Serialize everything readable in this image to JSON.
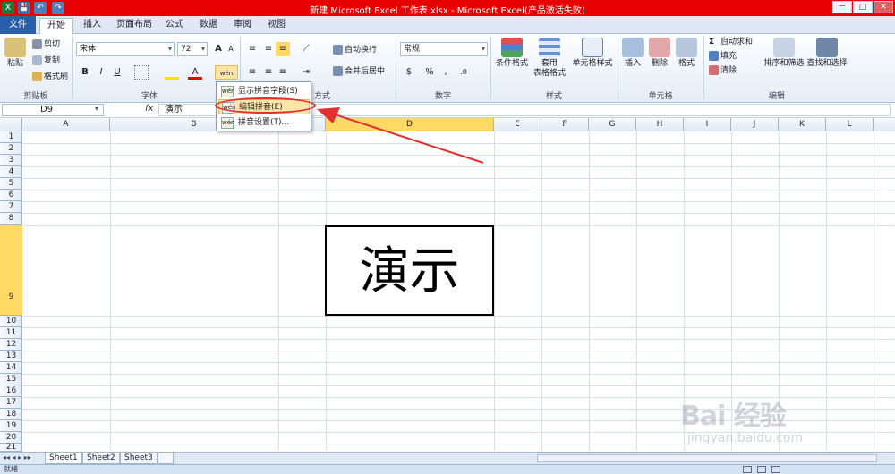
{
  "window": {
    "title": "新建 Microsoft Excel 工作表.xlsx - Microsoft Excel(产品激活失败)",
    "controls": [
      "－",
      "□",
      "✕"
    ]
  },
  "quick_access": [
    "X",
    "💾",
    "↶",
    "↷"
  ],
  "tabs": [
    "文件",
    "开始",
    "插入",
    "页面布局",
    "公式",
    "数据",
    "审阅",
    "视图"
  ],
  "ribbon": {
    "clipboard": {
      "label": "剪贴板",
      "paste": "粘贴",
      "cut": "剪切",
      "copy": "复制",
      "format_painter": "格式刷"
    },
    "font": {
      "label": "字体",
      "font_name": "宋体",
      "font_size": "72",
      "bold": "B",
      "italic": "I",
      "underline": "U",
      "grow": "A",
      "shrink": "A",
      "phonetic_icon": "wén"
    },
    "alignment": {
      "label": "方式",
      "wrap": "自动换行",
      "merge": "合并后居中"
    },
    "number": {
      "label": "数字",
      "format": "常规",
      "percent": "%",
      "comma": ","
    },
    "styles": {
      "label": "样式",
      "conditional": "条件格式",
      "table_line1": "套用",
      "table_line2": "表格格式",
      "cell_styles": "单元格样式"
    },
    "cells": {
      "label": "单元格",
      "insert": "插入",
      "delete": "删除",
      "format": "格式"
    },
    "editing": {
      "label": "编辑",
      "autosum": "自动求和",
      "fill": "填充",
      "clear": "清除",
      "sort": "排序和筛选",
      "find": "查找和选择"
    }
  },
  "phonetic_menu": {
    "items": [
      {
        "label": "显示拼音字段(S)",
        "icon": "wén"
      },
      {
        "label": "编辑拼音(E)",
        "icon": "wén"
      },
      {
        "label": "拼音设置(T)...",
        "icon": "wén"
      }
    ]
  },
  "formula_bar": {
    "name_box": "D9",
    "fx": "fx",
    "value": "演示"
  },
  "columns": [
    "A",
    "B",
    "C",
    "D",
    "E",
    "F",
    "G",
    "H",
    "I",
    "J",
    "K",
    "L"
  ],
  "rows": [
    "1",
    "2",
    "3",
    "4",
    "5",
    "6",
    "7",
    "8",
    "9",
    "10",
    "11",
    "12",
    "13",
    "14",
    "15",
    "16",
    "17",
    "18",
    "19",
    "20",
    "21"
  ],
  "cell_d9": "演示",
  "sheets": [
    "Sheet1",
    "Sheet2",
    "Sheet3"
  ],
  "status": "就绪",
  "watermark": {
    "logo": "Bai 经验",
    "sub": "jingyan.baidu.com"
  },
  "colors": {
    "titlebar": "#e60000",
    "annotation": "#e03030",
    "selected_header": "#ffd966"
  }
}
